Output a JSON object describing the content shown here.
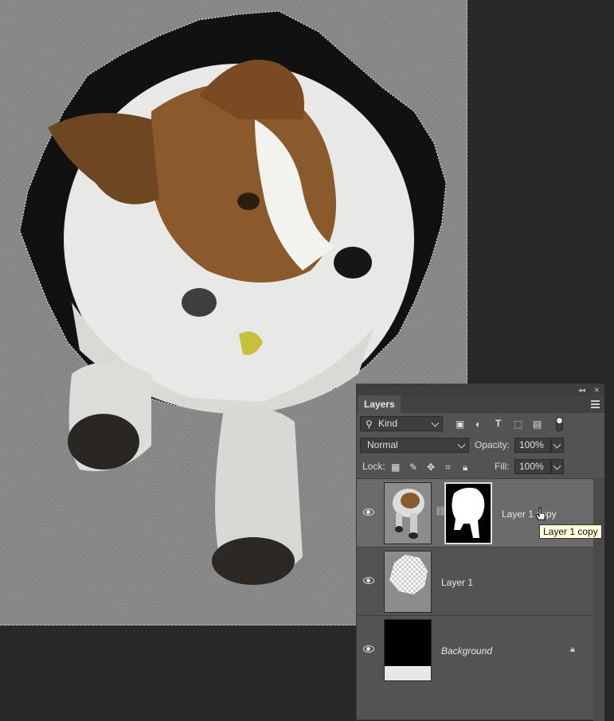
{
  "panel": {
    "tab_label": "Layers",
    "filter": {
      "kind_label": "Kind"
    },
    "blend_mode": "Normal",
    "opacity_label": "Opacity:",
    "opacity_value": "100%",
    "lock_label": "Lock:",
    "fill_label": "Fill:",
    "fill_value": "100%"
  },
  "layers": [
    {
      "name": "Layer 1 copy",
      "selected": true,
      "has_mask": true
    },
    {
      "name": "Layer 1",
      "selected": false,
      "has_mask": false
    },
    {
      "name": "Background",
      "selected": false,
      "has_mask": false,
      "locked": true
    }
  ],
  "tooltip": "Layer 1 copy",
  "icons": {
    "filter": "search-icon",
    "kind_filters": [
      "image-filter-icon",
      "adjustment-filter-icon",
      "type-filter-icon",
      "shape-filter-icon",
      "smart-object-filter-icon",
      "filter-toggle-icon"
    ],
    "lock": [
      "lock-transparent-icon",
      "lock-paint-icon",
      "lock-position-icon",
      "lock-artboard-icon",
      "lock-all-icon"
    ],
    "visibility": "eye-icon",
    "chain": "link-icon",
    "layer_lock": "lock-icon"
  },
  "colors": {
    "canvas_bg": "#8c8c8c",
    "workspace_bg": "#282828",
    "panel_bg": "#535353",
    "selected_row": "#6a6a6a",
    "tooltip_bg": "#ffffdc"
  }
}
